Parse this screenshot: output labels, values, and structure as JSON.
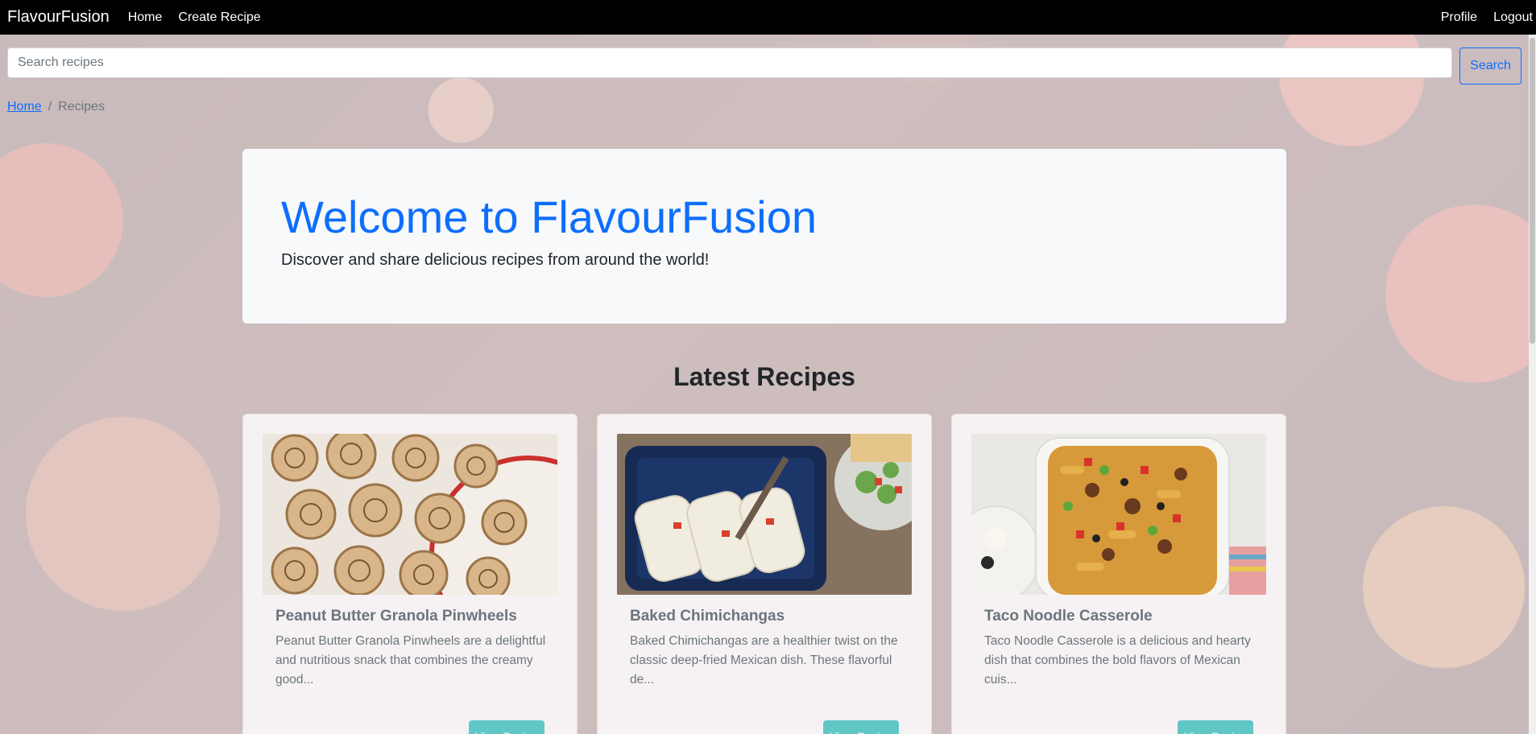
{
  "navbar": {
    "brand": "FlavourFusion",
    "links": [
      "Home",
      "Create Recipe"
    ],
    "right_links": [
      "Profile",
      "Logout"
    ]
  },
  "search": {
    "placeholder": "Search recipes",
    "button_label": "Search"
  },
  "breadcrumb": {
    "home": "Home",
    "separator": "/",
    "current": "Recipes"
  },
  "hero": {
    "title": "Welcome to FlavourFusion",
    "subtitle": "Discover and share delicious recipes from around the world!"
  },
  "section_title": "Latest Recipes",
  "recipes": [
    {
      "title": "Peanut Butter Granola Pinwheels",
      "description": "Peanut Butter Granola Pinwheels are a delightful and nutritious snack that combines the creamy good...",
      "button_label": "View Recipe"
    },
    {
      "title": "Baked Chimichangas",
      "description": "Baked Chimichangas are a healthier twist on the classic deep-fried Mexican dish. These flavorful de...",
      "button_label": "View Recipe"
    },
    {
      "title": "Taco Noodle Casserole",
      "description": "Taco Noodle Casserole is a delicious and hearty dish that combines the bold flavors of Mexican cuis...",
      "button_label": "View Recipe"
    }
  ],
  "colors": {
    "primary": "#0d6efd",
    "navbar": "#000000",
    "card_button": "#5fc8c6"
  }
}
